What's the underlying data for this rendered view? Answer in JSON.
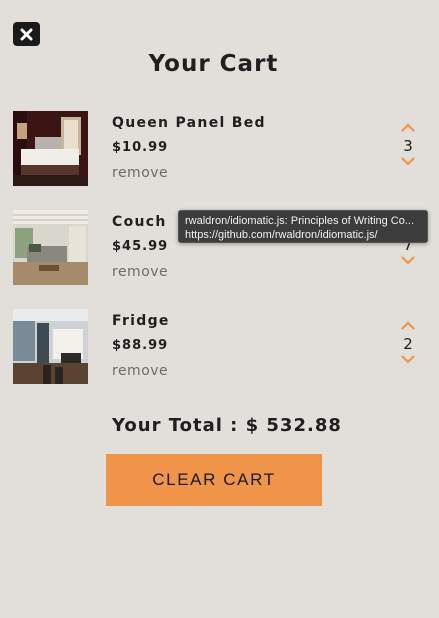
{
  "header": {
    "close_icon": "close-x-icon",
    "title": "Your Cart"
  },
  "items": [
    {
      "name": "Queen Panel Bed",
      "price": "$10.99",
      "remove": "remove",
      "quantity": "3",
      "image": "bedroom-photo"
    },
    {
      "name": "Couch",
      "price": "$45.99",
      "remove": "remove",
      "quantity": "7",
      "image": "living-room-photo"
    },
    {
      "name": "Fridge",
      "price": "$88.99",
      "remove": "remove",
      "quantity": "2",
      "image": "kitchen-photo"
    }
  ],
  "total": {
    "text": "Your Total : $ 532.88"
  },
  "clear_button": {
    "label": "CLEAR CART"
  },
  "tooltip": {
    "line1": "rwaldron/idiomatic.js: Principles of Writing Co...",
    "line2": "https://github.com/rwaldron/idiomatic.js/"
  },
  "colors": {
    "background": "#e2ded9",
    "accent": "#ef9449",
    "text": "#1f1f1f",
    "muted": "#6e6b67"
  }
}
